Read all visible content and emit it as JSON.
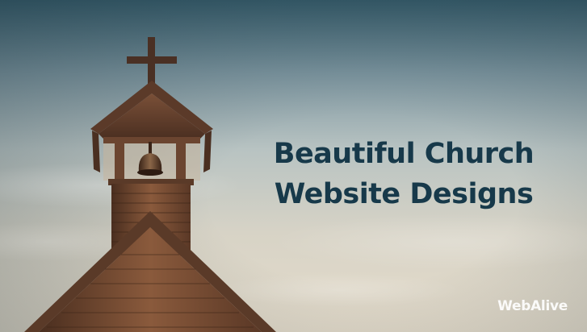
{
  "headline": {
    "line1": "Beautiful Church",
    "line2": "Website Designs"
  },
  "brand": {
    "name": "WebAlive"
  },
  "colors": {
    "headline": "#17394a",
    "brand": "#ffffff"
  }
}
